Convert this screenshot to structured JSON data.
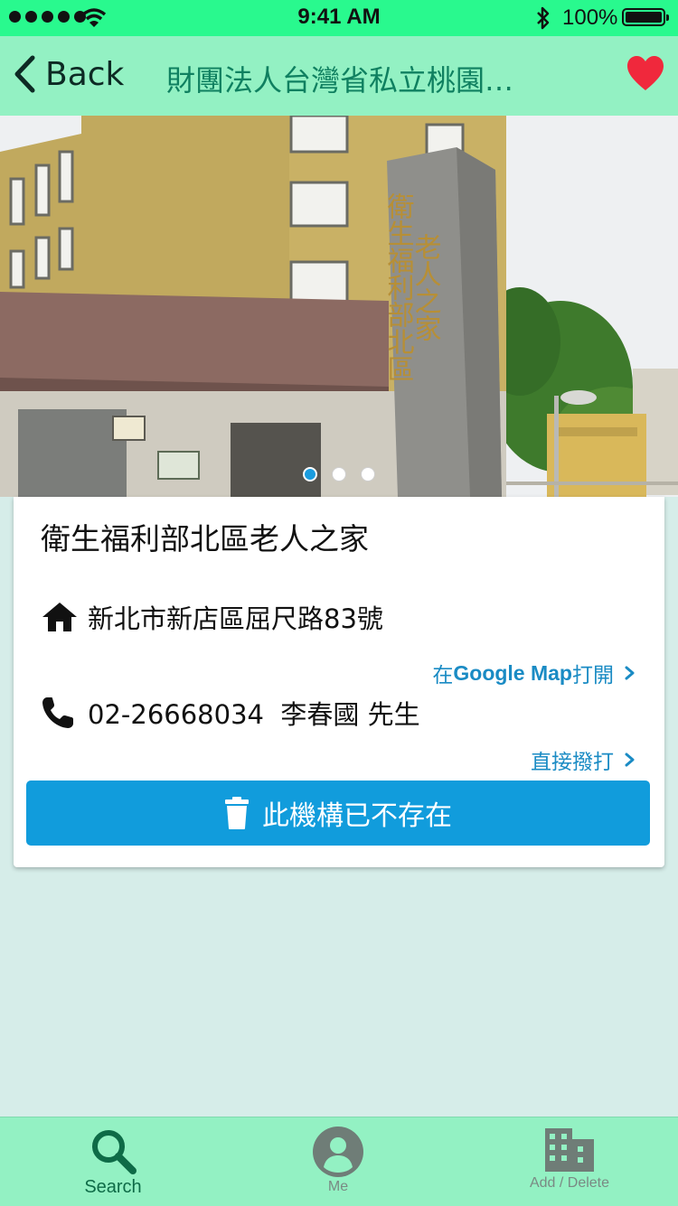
{
  "status_bar": {
    "time": "9:41 AM",
    "battery": "100%"
  },
  "nav": {
    "back_label": "Back",
    "title": "財團法人台灣省私立桃園仁愛之家"
  },
  "photo": {
    "sign_text": "衛生福利部北區老人之家",
    "pages": 3,
    "current_page": 1
  },
  "facility": {
    "name": "衛生福利部北區老人之家",
    "address": "新北市新店區屈尺路83號",
    "map_link_prefix": "在",
    "map_link_brand": "Google Map",
    "map_link_suffix": "打開",
    "phone": "02-26668034  李春國 先生",
    "call_link": "直接撥打",
    "delete_label": "此機構已不存在"
  },
  "tabs": [
    {
      "label": "Search",
      "icon": "search-icon"
    },
    {
      "label": "Me",
      "icon": "user-icon"
    },
    {
      "label": "Add / Delete",
      "icon": "building-icon"
    }
  ],
  "colors": {
    "status_bar": "#29f98e",
    "nav_bar": "#93f1c3",
    "title_text": "#0f8060",
    "link": "#1a8bc4",
    "button": "#119cdc",
    "heart": "#f0283c",
    "background": "#d6ede9"
  }
}
